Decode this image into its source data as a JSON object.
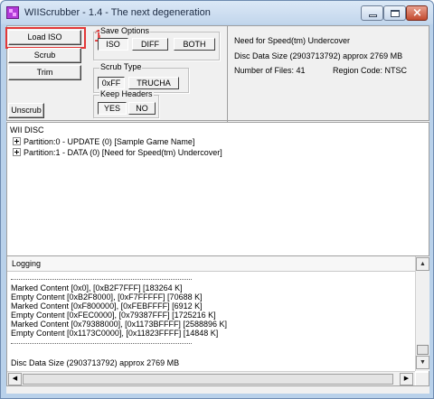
{
  "window": {
    "title": "WIIScrubber - 1.4 - The next degeneration"
  },
  "buttons": {
    "load_iso": "Load ISO",
    "scrub": "Scrub",
    "trim": "Trim",
    "unscrub": "Unscrub"
  },
  "annotation": {
    "step": "1",
    "color": "#e23838"
  },
  "save_options": {
    "label": "Save Options",
    "iso": "ISO",
    "diff": "DIFF",
    "both": "BOTH"
  },
  "scrub_type": {
    "label": "Scrub Type",
    "oxff": "0xFF",
    "trucha": "TRUCHA"
  },
  "keep_headers": {
    "label": "Keep Headers",
    "yes": "YES",
    "no": "NO"
  },
  "disc_info": {
    "name": "Need for Speed(tm) Undercover",
    "size": "Disc Data Size (2903713792) approx  2769 MB",
    "files": "Number of Files: 41",
    "region": "Region Code: NTSC"
  },
  "tree": {
    "root": "WII DISC",
    "items": [
      "Partition:0 - UPDATE (0) [Sample Game Name]",
      "Partition:1 - DATA (0) [Need for Speed(tm) Undercover]"
    ]
  },
  "log": {
    "header": "Logging",
    "lines": [
      "Marked Content [0x0], [0xB2F7FFF] [183264 K]",
      "Empty Content [0xB2F8000], [0xF7FFFFF] [70688 K]",
      "Marked Content [0xF800000], [0xFEBFFFF] [6912 K]",
      "Empty Content [0xFEC0000], [0x79387FFF] [1725216 K]",
      "Marked Content [0x79388000], [0x1173BFFFF] [2588896 K]",
      "Empty Content [0x1173C0000], [0x11823FFFF] [14848 K]"
    ],
    "footer": "Disc Data Size (2903713792) approx  2769 MB"
  },
  "icons": {
    "app": "wiiscrubber-app-icon",
    "minimize": "minimize-icon",
    "maximize": "maximize-icon",
    "close": "close-icon",
    "expand": "plus-box-icon",
    "scroll_up": "arrow-up-icon",
    "scroll_down": "arrow-down-icon",
    "scroll_left": "arrow-left-icon",
    "scroll_right": "arrow-right-icon"
  },
  "colors": {
    "title_bar": "#c2d6ec",
    "close_button": "#c24a2e",
    "highlight": "#e23838"
  }
}
